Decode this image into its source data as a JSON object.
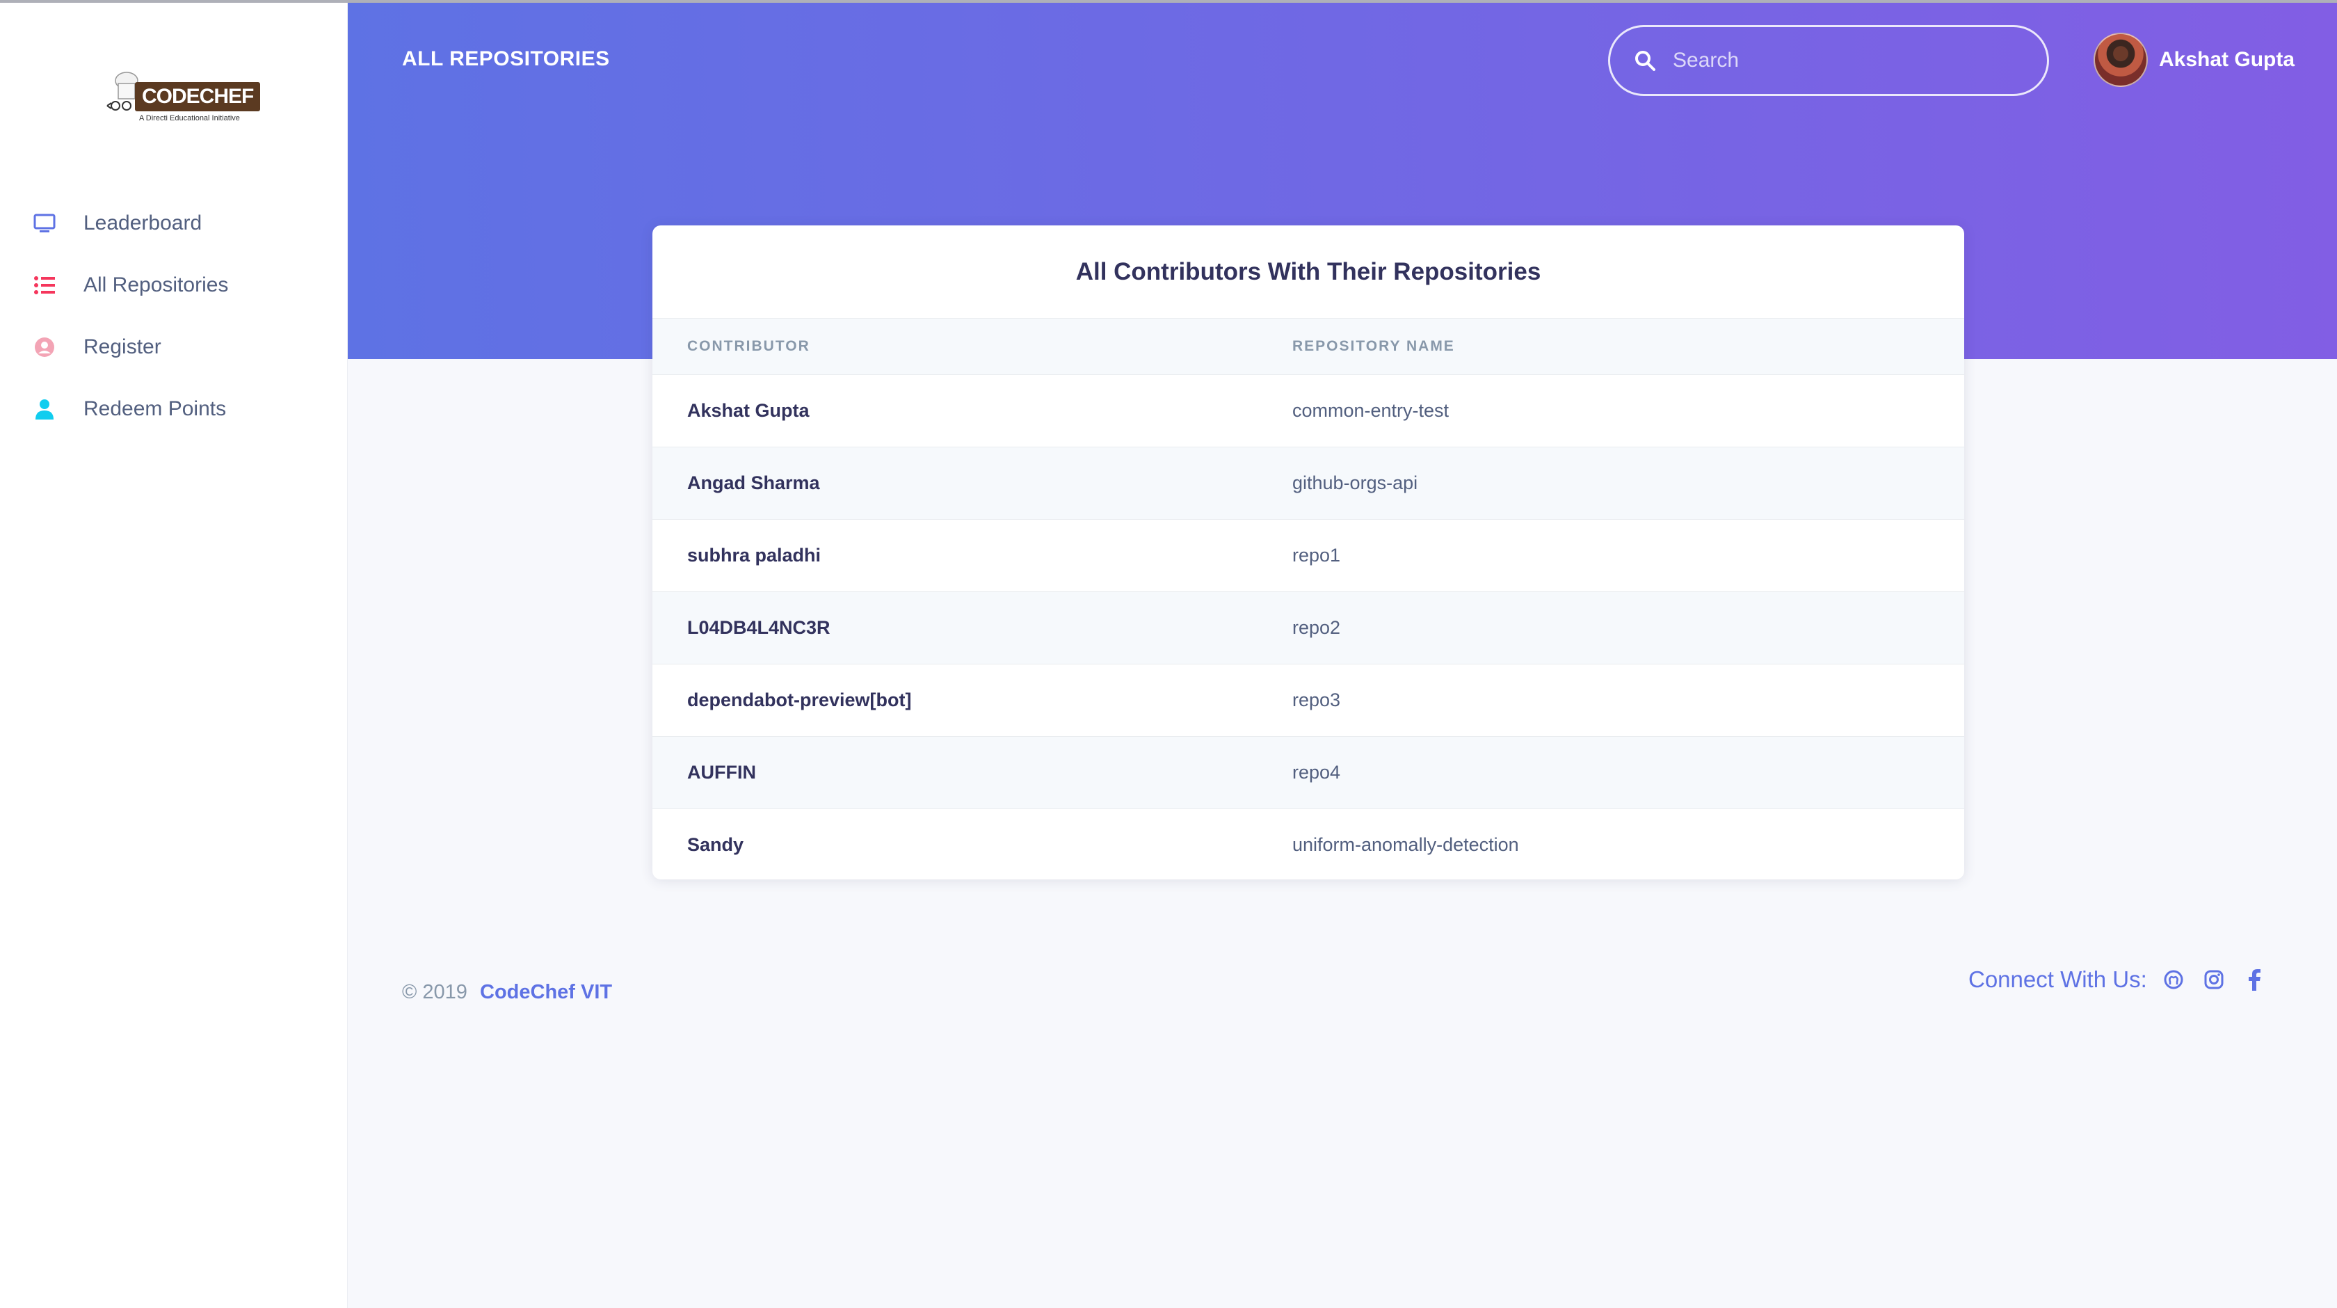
{
  "brand": {
    "logo_text": "CODECHEF",
    "logo_subtext": "A Directi Educational Initiative"
  },
  "sidebar": {
    "items": [
      {
        "label": "Leaderboard",
        "icon": "monitor-icon",
        "color": "#5e72e4"
      },
      {
        "label": "All Repositories",
        "icon": "list-icon",
        "color": "#f5365c"
      },
      {
        "label": "Register",
        "icon": "user-circle-icon",
        "color": "#f3a4b5"
      },
      {
        "label": "Redeem Points",
        "icon": "person-icon",
        "color": "#11cdef"
      }
    ]
  },
  "header": {
    "title": "ALL REPOSITORIES",
    "search_placeholder": "Search",
    "user_name": "Akshat Gupta",
    "gradient_start": "#5e72e4",
    "gradient_end": "#825ee4"
  },
  "card": {
    "title": "All Contributors With Their Repositories",
    "columns": [
      "CONTRIBUTOR",
      "REPOSITORY NAME"
    ],
    "rows": [
      {
        "contributor": "Akshat Gupta",
        "repository": "common-entry-test"
      },
      {
        "contributor": "Angad Sharma",
        "repository": "github-orgs-api"
      },
      {
        "contributor": "subhra paladhi",
        "repository": "repo1"
      },
      {
        "contributor": "L04DB4L4NC3R",
        "repository": "repo2"
      },
      {
        "contributor": "dependabot-preview[bot]",
        "repository": "repo3"
      },
      {
        "contributor": "AUFFIN",
        "repository": "repo4"
      },
      {
        "contributor": "Sandy",
        "repository": "uniform-anomally-detection"
      }
    ]
  },
  "footer": {
    "copyright": "© 2019",
    "org_link": "CodeChef VIT",
    "connect_label": "Connect With Us:",
    "social_icons": [
      "github-icon",
      "instagram-icon",
      "facebook-icon"
    ]
  }
}
